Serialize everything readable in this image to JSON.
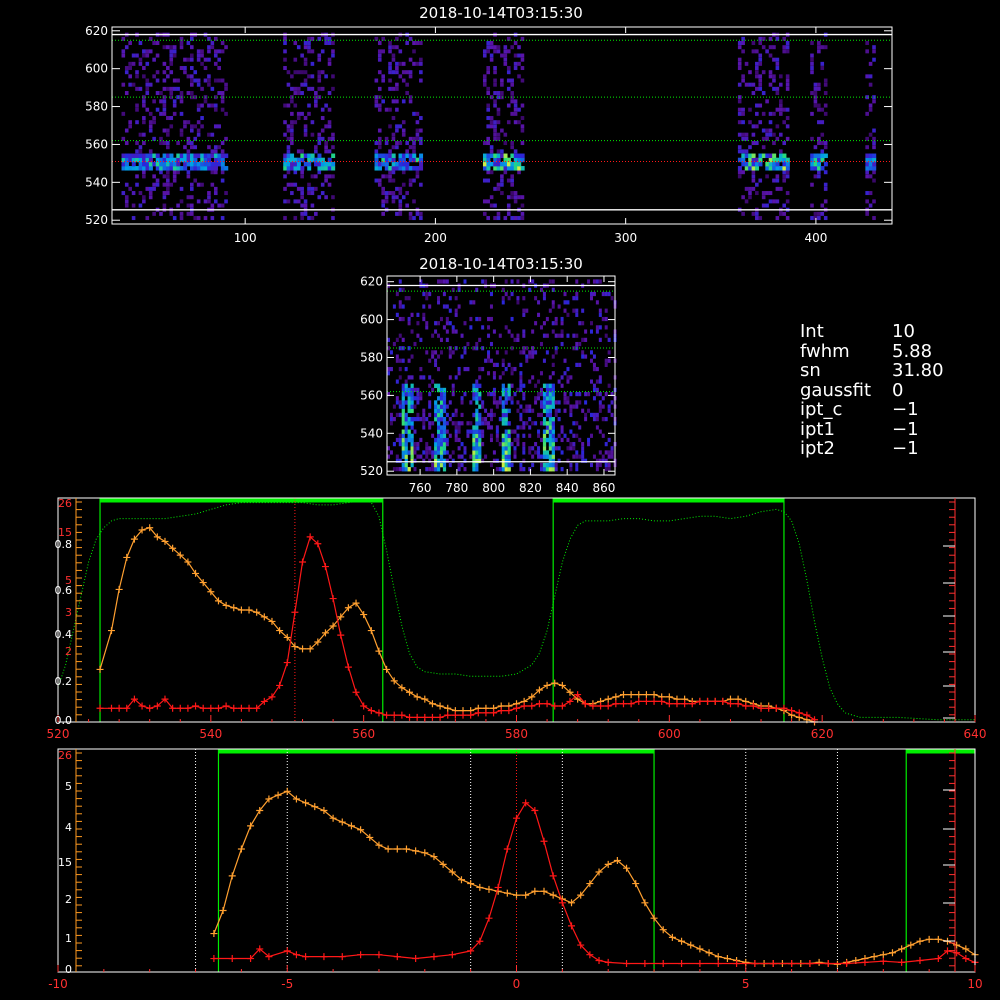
{
  "colors": {
    "background": "#000000",
    "axes": "#ffffff",
    "green": "#00ee00",
    "red": "#ff1818",
    "orange": "#ffa030",
    "left_axis_orange": "#ff9a20",
    "left_axis_red": "#ff3030"
  },
  "info": [
    {
      "key": "Int",
      "value": "10"
    },
    {
      "key": "fwhm",
      "value": "5.88"
    },
    {
      "key": "sn",
      "value": "31.80"
    },
    {
      "key": "gaussfit",
      "value": "0"
    },
    {
      "key": "ipt_c",
      "value": "−1"
    },
    {
      "key": "ipt1",
      "value": "−1"
    },
    {
      "key": "ipt2",
      "value": "−1"
    }
  ],
  "chart_data": [
    {
      "type": "heatmap",
      "title": "2018-10-14T03:15:30",
      "xlim": [
        30,
        440
      ],
      "ylim": [
        518,
        622
      ],
      "xticks": [
        100,
        200,
        300,
        400
      ],
      "yticks": [
        520,
        540,
        560,
        580,
        600,
        620
      ],
      "colormap": "rainbow-dark",
      "bright_columns": [
        [
          35,
          90
        ],
        [
          120,
          146
        ],
        [
          168,
          193
        ],
        [
          225,
          245
        ],
        [
          359,
          385
        ],
        [
          397,
          405
        ],
        [
          426,
          430
        ]
      ],
      "emission_row_y": 550,
      "white_lines_y": [
        525.5,
        618
      ],
      "green_dotted_y": [
        562,
        585,
        615
      ],
      "red_dotted_y": 551
    },
    {
      "type": "heatmap",
      "title": "2018-10-14T03:15:30",
      "xlim": [
        742,
        866
      ],
      "ylim": [
        518,
        623
      ],
      "xticks": [
        760,
        780,
        800,
        820,
        840,
        860
      ],
      "yticks": [
        520,
        540,
        560,
        580,
        600,
        620
      ],
      "colormap": "rainbow-dark",
      "bright_streaks_x": [
        752,
        770,
        790,
        806,
        829
      ],
      "white_lines_y": [
        525,
        618
      ],
      "green_dotted_y": [
        562,
        585,
        615
      ]
    },
    {
      "type": "line",
      "xlim": [
        520,
        640
      ],
      "xticks": [
        520,
        540,
        560,
        580,
        600,
        620,
        640
      ],
      "yticks_orange": [
        "0.0",
        "0.2",
        "0.4",
        "0.6",
        "0.8"
      ],
      "yticks_red": [
        "2",
        "3",
        "5",
        "15",
        "26"
      ],
      "ylim": [
        0,
        0.98
      ],
      "filter_windows": [
        [
          525.5,
          562.5
        ],
        [
          584.8,
          615
        ]
      ],
      "red_dotted_x": 551,
      "series": [
        {
          "color": "orange",
          "x": [
            525.5,
            527,
            528,
            529,
            530,
            531,
            532,
            533,
            534,
            535,
            536,
            537,
            538,
            539,
            540,
            541,
            542,
            543,
            544,
            545,
            546,
            547,
            548,
            549,
            550,
            551,
            552,
            553,
            554,
            555,
            556,
            557,
            558,
            559,
            560,
            561,
            562,
            563,
            564,
            565,
            566,
            567,
            568,
            569,
            570,
            571,
            572,
            573,
            574,
            575,
            576,
            577,
            578,
            579,
            580,
            581,
            582,
            583,
            584,
            585,
            586,
            587,
            588,
            589,
            590,
            591,
            592,
            593,
            594,
            595,
            596,
            597,
            598,
            599,
            600,
            601,
            602,
            603,
            604,
            605,
            606,
            607,
            608,
            609,
            610,
            611,
            612,
            613,
            614,
            615,
            616,
            617,
            618,
            619
          ],
          "y": [
            0.23,
            0.4,
            0.58,
            0.72,
            0.8,
            0.84,
            0.85,
            0.81,
            0.79,
            0.76,
            0.73,
            0.7,
            0.65,
            0.61,
            0.57,
            0.53,
            0.51,
            0.5,
            0.49,
            0.49,
            0.48,
            0.46,
            0.44,
            0.4,
            0.37,
            0.33,
            0.32,
            0.32,
            0.35,
            0.39,
            0.42,
            0.46,
            0.5,
            0.52,
            0.47,
            0.4,
            0.31,
            0.23,
            0.18,
            0.15,
            0.13,
            0.11,
            0.1,
            0.08,
            0.07,
            0.06,
            0.05,
            0.05,
            0.05,
            0.06,
            0.06,
            0.06,
            0.07,
            0.07,
            0.08,
            0.09,
            0.11,
            0.14,
            0.16,
            0.17,
            0.16,
            0.13,
            0.1,
            0.08,
            0.08,
            0.09,
            0.1,
            0.11,
            0.12,
            0.12,
            0.12,
            0.12,
            0.12,
            0.11,
            0.11,
            0.1,
            0.1,
            0.09,
            0.09,
            0.09,
            0.09,
            0.09,
            0.1,
            0.1,
            0.09,
            0.08,
            0.07,
            0.07,
            0.06,
            0.05,
            0.03,
            0.02,
            0.01,
            0.0
          ]
        },
        {
          "color": "red",
          "x": [
            525.5,
            527,
            528,
            529,
            530,
            531,
            532,
            533,
            534,
            535,
            536,
            537,
            538,
            539,
            540,
            541,
            542,
            543,
            544,
            545,
            546,
            547,
            548,
            549,
            550,
            551,
            552,
            553,
            554,
            555,
            556,
            557,
            558,
            559,
            560,
            561,
            562,
            563,
            564,
            565,
            566,
            567,
            568,
            569,
            570,
            571,
            572,
            573,
            574,
            575,
            576,
            577,
            578,
            579,
            580,
            581,
            582,
            583,
            584,
            585,
            586,
            587,
            588,
            589,
            590,
            591,
            592,
            593,
            594,
            595,
            596,
            597,
            598,
            599,
            600,
            601,
            602,
            603,
            604,
            605,
            606,
            607,
            608,
            609,
            610,
            611,
            612,
            613,
            614,
            615,
            616,
            617,
            618,
            619
          ],
          "y": [
            0.06,
            0.06,
            0.06,
            0.06,
            0.1,
            0.07,
            0.06,
            0.07,
            0.1,
            0.06,
            0.06,
            0.06,
            0.07,
            0.06,
            0.06,
            0.06,
            0.07,
            0.06,
            0.06,
            0.06,
            0.06,
            0.09,
            0.11,
            0.16,
            0.26,
            0.48,
            0.7,
            0.81,
            0.78,
            0.68,
            0.54,
            0.38,
            0.24,
            0.13,
            0.07,
            0.05,
            0.04,
            0.03,
            0.03,
            0.03,
            0.02,
            0.02,
            0.02,
            0.02,
            0.02,
            0.03,
            0.03,
            0.03,
            0.03,
            0.04,
            0.04,
            0.04,
            0.05,
            0.05,
            0.06,
            0.07,
            0.07,
            0.08,
            0.08,
            0.07,
            0.07,
            0.09,
            0.12,
            0.08,
            0.07,
            0.07,
            0.07,
            0.08,
            0.08,
            0.08,
            0.09,
            0.09,
            0.09,
            0.09,
            0.08,
            0.08,
            0.08,
            0.08,
            0.09,
            0.09,
            0.09,
            0.09,
            0.08,
            0.08,
            0.07,
            0.07,
            0.06,
            0.06,
            0.06,
            0.06,
            0.05,
            0.04,
            0.03,
            0.01
          ]
        },
        {
          "color": "green",
          "style": "dotted",
          "x": [
            520,
            521,
            522,
            523,
            524,
            525,
            526,
            527,
            528,
            529,
            530,
            532,
            534,
            536,
            538,
            540,
            542,
            544,
            546,
            548,
            550,
            552,
            554,
            556,
            558,
            560,
            561,
            562,
            563,
            564,
            565,
            566,
            567,
            568,
            570,
            572,
            574,
            576,
            578,
            580,
            582,
            583,
            584,
            585,
            586,
            587,
            588,
            589,
            590,
            592,
            594,
            596,
            598,
            600,
            602,
            604,
            606,
            608,
            610,
            612,
            614,
            615,
            616,
            617,
            618,
            619,
            620,
            621,
            622,
            623,
            625,
            630,
            635,
            640
          ],
          "y": [
            0.15,
            0.25,
            0.4,
            0.55,
            0.7,
            0.8,
            0.85,
            0.88,
            0.89,
            0.89,
            0.89,
            0.89,
            0.89,
            0.9,
            0.91,
            0.93,
            0.95,
            0.96,
            0.96,
            0.96,
            0.96,
            0.96,
            0.95,
            0.95,
            0.96,
            0.97,
            0.96,
            0.9,
            0.75,
            0.58,
            0.42,
            0.3,
            0.24,
            0.22,
            0.21,
            0.21,
            0.2,
            0.2,
            0.2,
            0.21,
            0.25,
            0.3,
            0.4,
            0.55,
            0.7,
            0.8,
            0.86,
            0.88,
            0.88,
            0.88,
            0.89,
            0.89,
            0.88,
            0.88,
            0.89,
            0.9,
            0.9,
            0.89,
            0.9,
            0.92,
            0.93,
            0.92,
            0.88,
            0.78,
            0.62,
            0.44,
            0.28,
            0.15,
            0.08,
            0.04,
            0.02,
            0.02,
            0.01,
            0.01
          ]
        }
      ]
    },
    {
      "type": "line",
      "xlim": [
        -10,
        10
      ],
      "xticks": [
        -10,
        -5,
        0,
        5,
        10
      ],
      "yticks_orange": [
        "0",
        "1",
        "2",
        "15",
        "4",
        "5"
      ],
      "yticks_red": [
        "26"
      ],
      "ylim": [
        0,
        5.8
      ],
      "filter_windows": [
        [
          -6.5,
          3.0
        ],
        [
          8.5,
          10
        ]
      ],
      "white_dotted_x": [
        -7,
        -5,
        -1,
        1,
        5,
        7
      ],
      "red_dotted_x": 0,
      "series": [
        {
          "color": "orange",
          "x": [
            -6.6,
            -6.4,
            -6.2,
            -6.0,
            -5.8,
            -5.6,
            -5.4,
            -5.2,
            -5.0,
            -4.8,
            -4.6,
            -4.4,
            -4.2,
            -4.0,
            -3.8,
            -3.6,
            -3.4,
            -3.2,
            -3.0,
            -2.8,
            -2.6,
            -2.4,
            -2.2,
            -2.0,
            -1.8,
            -1.6,
            -1.4,
            -1.2,
            -1.0,
            -0.8,
            -0.6,
            -0.4,
            -0.2,
            0.0,
            0.2,
            0.4,
            0.6,
            0.8,
            1.0,
            1.2,
            1.4,
            1.6,
            1.8,
            2.0,
            2.2,
            2.4,
            2.6,
            2.8,
            3.0,
            3.2,
            3.4,
            3.6,
            3.8,
            4.0,
            4.2,
            4.4,
            4.6,
            4.8,
            5.0,
            5.2,
            5.4,
            5.6,
            5.8,
            6.0,
            6.2,
            6.4,
            6.6,
            6.8,
            7.0,
            7.2,
            7.4,
            7.6,
            7.8,
            8.0,
            8.2,
            8.4,
            8.6,
            8.8,
            9.0,
            9.2,
            9.4,
            9.6,
            9.8,
            10.0
          ],
          "y": [
            1.0,
            1.6,
            2.5,
            3.2,
            3.8,
            4.2,
            4.5,
            4.6,
            4.7,
            4.5,
            4.4,
            4.3,
            4.2,
            4.0,
            3.9,
            3.8,
            3.7,
            3.5,
            3.3,
            3.2,
            3.2,
            3.2,
            3.15,
            3.1,
            3.0,
            2.8,
            2.6,
            2.4,
            2.3,
            2.2,
            2.15,
            2.1,
            2.05,
            2.0,
            2.0,
            2.1,
            2.1,
            2.0,
            1.9,
            1.8,
            2.0,
            2.3,
            2.6,
            2.8,
            2.9,
            2.7,
            2.3,
            1.8,
            1.4,
            1.1,
            0.9,
            0.8,
            0.7,
            0.6,
            0.5,
            0.4,
            0.35,
            0.3,
            0.25,
            0.22,
            0.22,
            0.22,
            0.22,
            0.22,
            0.22,
            0.22,
            0.25,
            0.22,
            0.2,
            0.25,
            0.3,
            0.35,
            0.4,
            0.45,
            0.5,
            0.6,
            0.7,
            0.8,
            0.85,
            0.85,
            0.8,
            0.7,
            0.6,
            0.45
          ]
        },
        {
          "color": "red",
          "x": [
            -6.6,
            -6.2,
            -5.8,
            -5.6,
            -5.4,
            -5.0,
            -4.8,
            -4.6,
            -4.2,
            -3.8,
            -3.4,
            -3.0,
            -2.6,
            -2.2,
            -1.8,
            -1.4,
            -1.0,
            -0.8,
            -0.6,
            -0.4,
            -0.2,
            0.0,
            0.2,
            0.4,
            0.6,
            0.8,
            1.0,
            1.2,
            1.4,
            1.6,
            1.8,
            2.0,
            2.4,
            2.8,
            3.2,
            3.6,
            4.0,
            4.4,
            4.8,
            5.2,
            5.6,
            6.0,
            6.4,
            6.8,
            7.2,
            7.6,
            8.0,
            8.4,
            8.8,
            9.2,
            9.4,
            9.6,
            9.8,
            10.0
          ],
          "y": [
            0.35,
            0.35,
            0.35,
            0.6,
            0.4,
            0.55,
            0.45,
            0.4,
            0.4,
            0.4,
            0.45,
            0.45,
            0.4,
            0.35,
            0.4,
            0.45,
            0.55,
            0.8,
            1.4,
            2.2,
            3.2,
            4.0,
            4.4,
            4.2,
            3.4,
            2.5,
            1.8,
            1.2,
            0.7,
            0.45,
            0.3,
            0.25,
            0.22,
            0.22,
            0.22,
            0.22,
            0.22,
            0.22,
            0.22,
            0.22,
            0.22,
            0.22,
            0.22,
            0.22,
            0.22,
            0.25,
            0.28,
            0.25,
            0.3,
            0.35,
            0.55,
            0.5,
            0.35,
            0.25
          ]
        }
      ]
    }
  ]
}
